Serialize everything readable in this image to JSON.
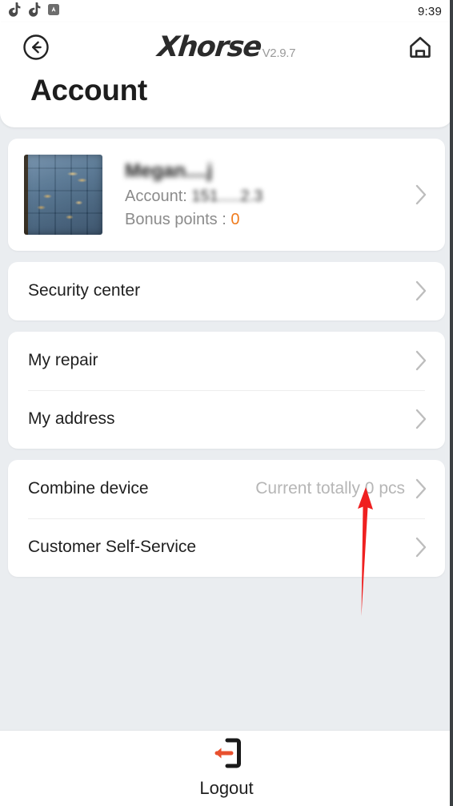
{
  "status_bar": {
    "icons": [
      "music-note-icon",
      "music-note-icon",
      "app-badge-icon"
    ],
    "time": "9:39"
  },
  "header": {
    "back_icon": "back-arrow-circle-icon",
    "home_icon": "home-icon",
    "brand": "Xhorse",
    "version": "V2.9.7",
    "page_title": "Account"
  },
  "profile": {
    "avatar_icon": "user-avatar-photo",
    "name": "Megan....j",
    "account_label": "Account:",
    "account_value": "151.....2.3",
    "bonus_label": "Bonus points :",
    "bonus_value": "0",
    "bonus_color": "#f07c1e",
    "chevron_icon": "chevron-right-icon"
  },
  "menu_groups": [
    {
      "rows": [
        {
          "label": "Security center",
          "value": "",
          "chevron_icon": "chevron-right-icon"
        }
      ]
    },
    {
      "rows": [
        {
          "label": "My repair",
          "value": "",
          "chevron_icon": "chevron-right-icon"
        },
        {
          "label": "My address",
          "value": "",
          "chevron_icon": "chevron-right-icon"
        }
      ]
    },
    {
      "rows": [
        {
          "label": "Combine device",
          "value": "Current totally 0 pcs",
          "chevron_icon": "chevron-right-icon"
        },
        {
          "label": "Customer Self-Service",
          "value": "",
          "chevron_icon": "chevron-right-icon"
        }
      ]
    }
  ],
  "annotation": {
    "type": "arrow",
    "color": "#ef2020",
    "points_to": "Current totally 0 pcs"
  },
  "bottom_bar": {
    "logout_icon": "logout-icon",
    "logout_label": "Logout",
    "logout_arrow_color": "#e8502e"
  },
  "colors": {
    "page_background": "#eaedf0",
    "card_background": "#ffffff",
    "primary_text": "#1d1d1d",
    "secondary_text": "#8b8b8b",
    "muted_value_text": "#b6b6b6",
    "accent_orange": "#f07c1e"
  }
}
